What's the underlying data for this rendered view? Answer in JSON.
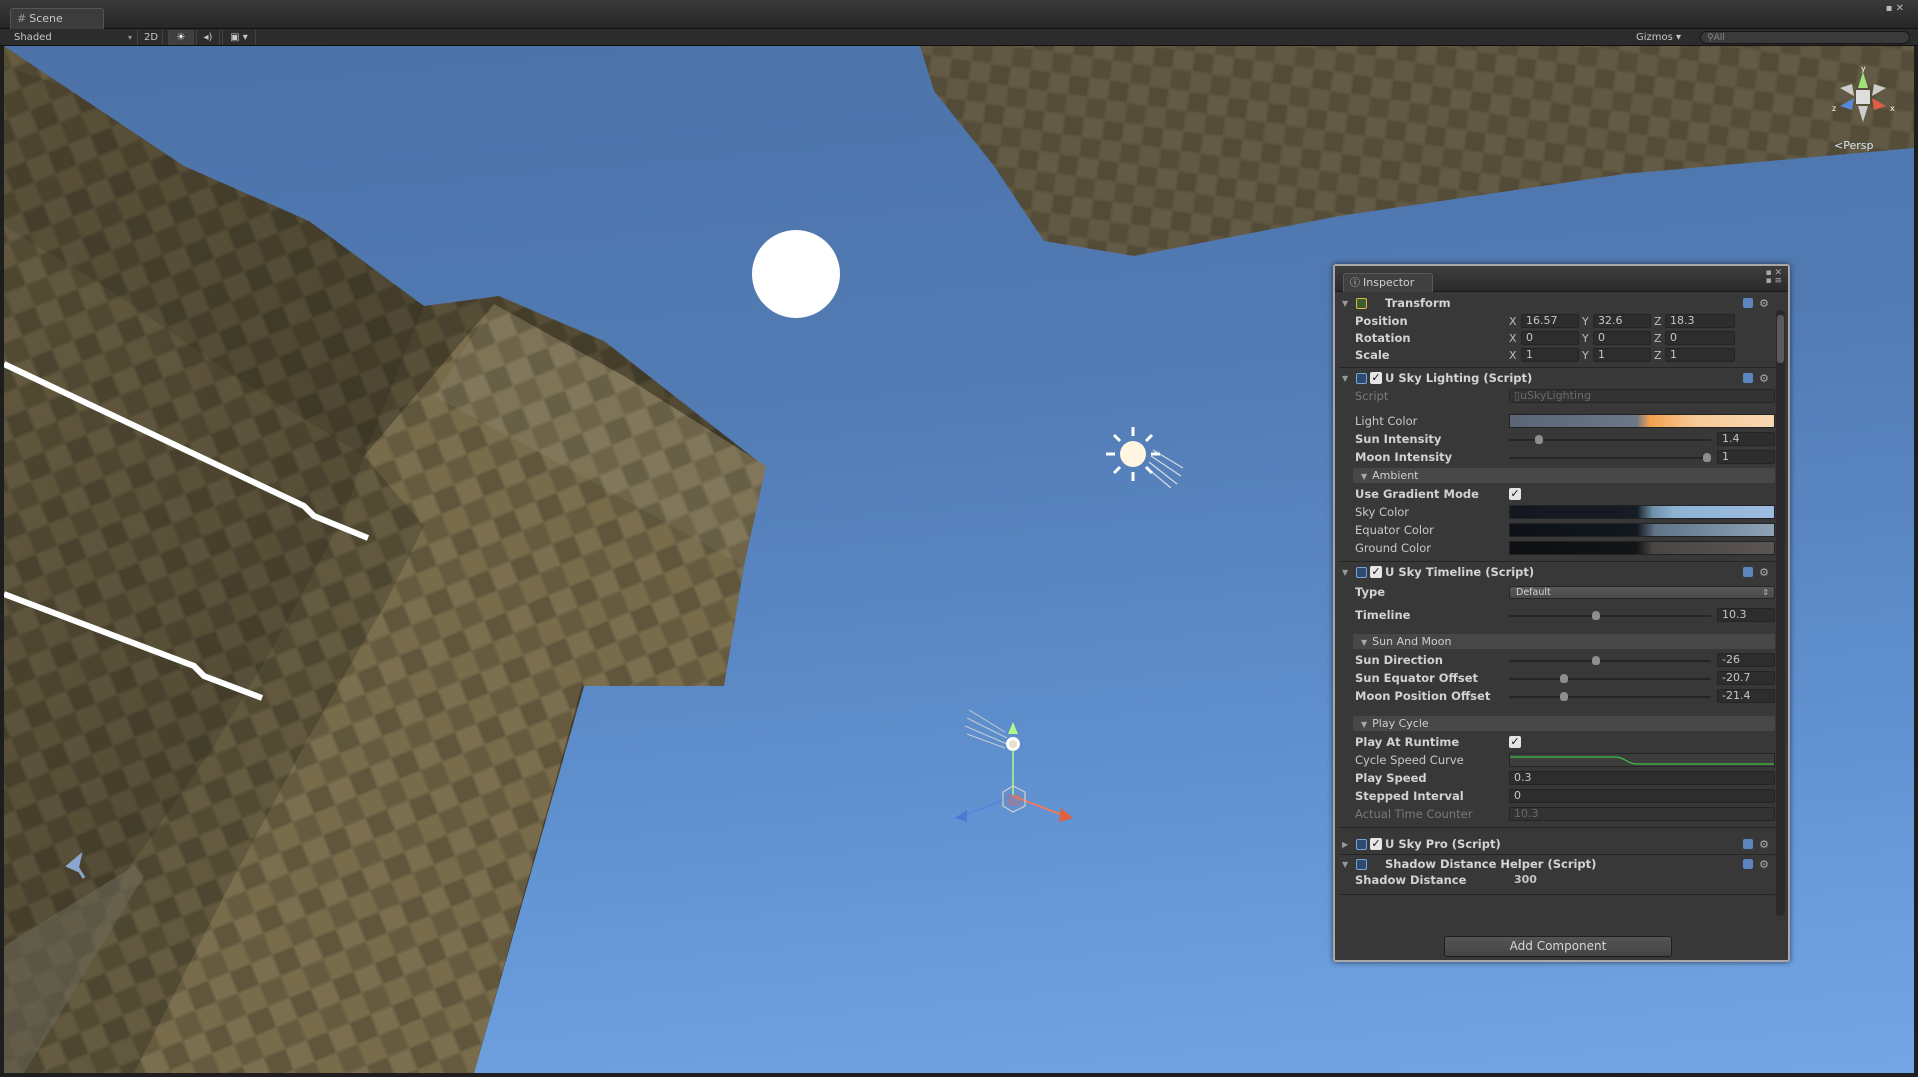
{
  "scene_window": {
    "tab_label": "Scene",
    "window_controls": "▪ ✕"
  },
  "toolbar": {
    "shading_mode": "Shaded",
    "mode_2d": "2D",
    "lighting_icon": "sun-icon",
    "audio_icon": "speaker-icon",
    "fx_icon": "image-effects-icon",
    "gizmos_label": "Gizmos",
    "search_placeholder": "All"
  },
  "viewport": {
    "projection_label": "Persp",
    "sky_color": "#5b87c2",
    "gizmo_axes": [
      "y",
      "x",
      "z"
    ]
  },
  "inspector": {
    "tab_label": "Inspector",
    "transform": {
      "title": "Transform",
      "position_label": "Position",
      "rotation_label": "Rotation",
      "scale_label": "Scale",
      "position": {
        "x": "16.57",
        "y": "32.6",
        "z": "18.3"
      },
      "rotation": {
        "x": "0",
        "y": "0",
        "z": "0"
      },
      "scale": {
        "x": "1",
        "y": "1",
        "z": "1"
      }
    },
    "sky_lighting": {
      "title": "U Sky Lighting (Script)",
      "script_label": "Script",
      "script_value": "uSkyLighting",
      "light_color_label": "Light Color",
      "sun_intensity_label": "Sun Intensity",
      "sun_intensity": "1.4",
      "sun_intensity_level": 0.15,
      "moon_intensity_label": "Moon Intensity",
      "moon_intensity": "1",
      "moon_intensity_level": 0.98,
      "ambient_header": "Ambient",
      "use_gradient_label": "Use Gradient Mode",
      "use_gradient_checked": true,
      "sky_color_label": "Sky Color",
      "equator_color_label": "Equator Color",
      "ground_color_label": "Ground Color"
    },
    "sky_timeline": {
      "title": "U Sky Timeline (Script)",
      "type_label": "Type",
      "type_value": "Default",
      "timeline_label": "Timeline",
      "timeline_value": "10.3",
      "timeline_level": 0.43,
      "sun_moon_header": "Sun And Moon",
      "sun_direction_label": "Sun Direction",
      "sun_direction": "-26",
      "sun_direction_level": 0.43,
      "sun_equator_label": "Sun Equator Offset",
      "sun_equator": "-20.7",
      "sun_equator_level": 0.27,
      "moon_position_label": "Moon Position Offset",
      "moon_position": "-21.4",
      "moon_position_level": 0.27,
      "play_cycle_header": "Play Cycle",
      "play_at_runtime_label": "Play At Runtime",
      "play_at_runtime_checked": true,
      "cycle_curve_label": "Cycle Speed Curve",
      "play_speed_label": "Play Speed",
      "play_speed": "0.3",
      "stepped_interval_label": "Stepped Interval",
      "stepped_interval": "0",
      "actual_time_label": "Actual Time Counter",
      "actual_time": "10.3"
    },
    "sky_pro": {
      "title": "U Sky Pro (Script)"
    },
    "shadow_helper": {
      "title": "Shadow Distance Helper (Script)",
      "shadow_distance_label": "Shadow Distance",
      "shadow_distance": "300"
    },
    "add_component_label": "Add Component"
  }
}
